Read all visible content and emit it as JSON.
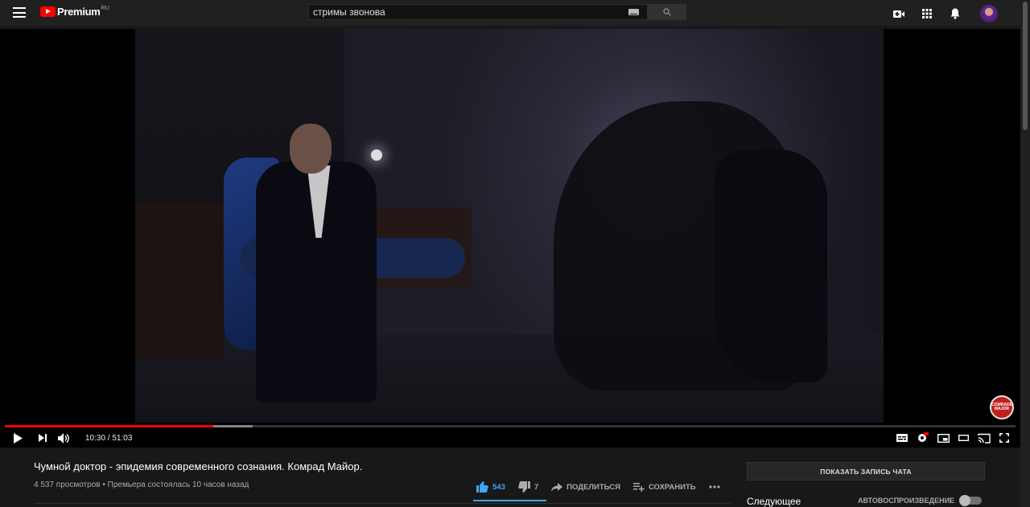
{
  "header": {
    "logo_text": "Premium",
    "logo_region": "RU",
    "search_value": "стримы звонова"
  },
  "player": {
    "current_time": "10:30",
    "duration": "51:03",
    "time_display": "10:30 / 51:03",
    "played_fraction": 0.206,
    "loaded_fraction": 0.245,
    "channel_badge": "COMRADE MAJOR"
  },
  "video": {
    "title": "Чумной доктор - эпидемия современного сознания. Комрад Майор.",
    "views": "4 537 просмотров",
    "premiere": "Премьера состоялась 10 часов назад",
    "meta_line": "4 537 просмотров • Премьера состоялась 10 часов назад",
    "likes": "543",
    "dislikes": "7",
    "share_label": "ПОДЕЛИТЬСЯ",
    "save_label": "СОХРАНИТЬ"
  },
  "sidebar": {
    "chat_button": "ПОКАЗАТЬ ЗАПИСЬ ЧАТА",
    "up_next": "Следующее",
    "autoplay_label": "АВТОВОСПРОИЗВЕДЕНИЕ",
    "autoplay_on": false
  },
  "colors": {
    "accent": "#3ea6ff",
    "progress": "#ff0000",
    "background": "#181818"
  }
}
